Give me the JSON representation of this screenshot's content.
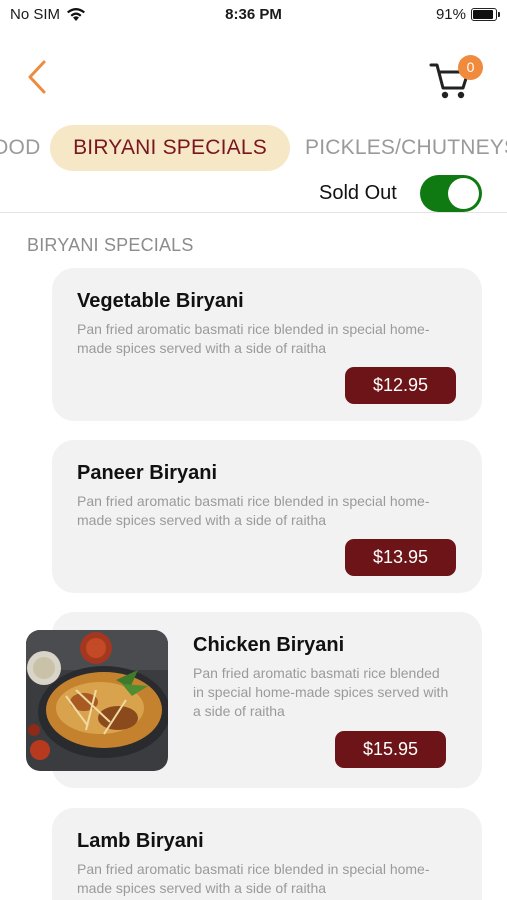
{
  "status_bar": {
    "carrier": "No SIM",
    "time": "8:36 PM",
    "battery": "91%",
    "battery_level": 0.91
  },
  "header": {
    "back_icon": "chevron-left-icon",
    "cart_icon": "cart-icon",
    "cart_count": "0"
  },
  "tabs": {
    "prev": "OOD",
    "active": "BIRYANI SPECIALS",
    "next": "PICKLES/CHUTNEYS"
  },
  "filter": {
    "sold_out_label": "Sold Out",
    "sold_out_on": true
  },
  "section": {
    "title": "BIRYANI SPECIALS"
  },
  "items": [
    {
      "name": "Vegetable Biryani",
      "description": "Pan fried aromatic basmati rice blended in special home-made spices served with a side of raitha",
      "price": "$12.95"
    },
    {
      "name": "Paneer Biryani",
      "description": "Pan fried aromatic basmati rice blended in special home-made spices served with a side of raitha",
      "price": "$13.95"
    },
    {
      "name": "Chicken Biryani",
      "description": "Pan fried aromatic basmati rice blended in special home-made spices served with a side of raitha",
      "price": "$15.95"
    },
    {
      "name": "Lamb Biryani",
      "description": "Pan fried aromatic basmati rice blended in special home-made spices served with a side of raitha",
      "price": ""
    }
  ],
  "colors": {
    "accent": "#f08a3c",
    "price_bg": "#6d1418",
    "tab_active_bg": "#f6e8c6",
    "tab_active_text": "#7a1620",
    "toggle_on": "#0f7a12"
  }
}
